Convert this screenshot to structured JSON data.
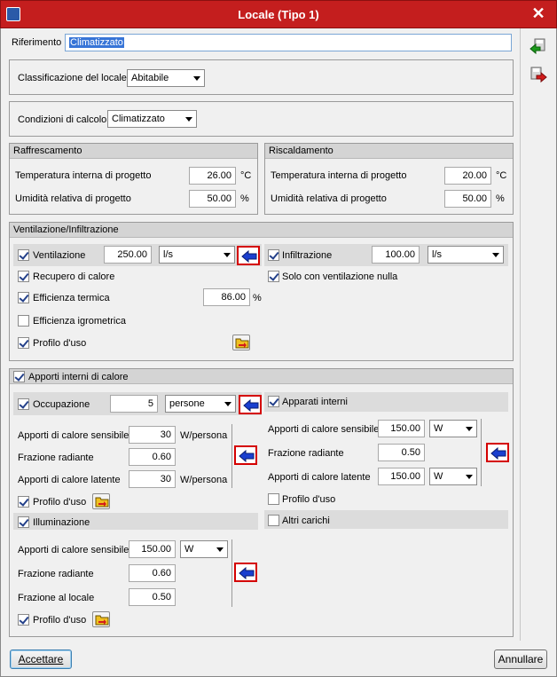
{
  "window": {
    "title": "Locale (Tipo 1)"
  },
  "riferimento": {
    "label": "Riferimento",
    "value": "Climatizzato"
  },
  "classificazione": {
    "label": "Classificazione del locale",
    "value": "Abitabile"
  },
  "condizioni": {
    "label": "Condizioni di calcolo",
    "value": "Climatizzato"
  },
  "raffrescamento": {
    "title": "Raffrescamento",
    "temp_label": "Temperatura interna di progetto",
    "temp_value": "26.00",
    "temp_unit": "°C",
    "umid_label": "Umidità relativa di progetto",
    "umid_value": "50.00",
    "umid_unit": "%"
  },
  "riscaldamento": {
    "title": "Riscaldamento",
    "temp_label": "Temperatura interna di progetto",
    "temp_value": "20.00",
    "temp_unit": "°C",
    "umid_label": "Umidità relativa di progetto",
    "umid_value": "50.00",
    "umid_unit": "%"
  },
  "ventilazione": {
    "title": "Ventilazione/Infiltrazione",
    "vent_label": "Ventilazione",
    "vent_checked": true,
    "vent_value": "250.00",
    "vent_unit": "l/s",
    "infil_label": "Infiltrazione",
    "infil_checked": true,
    "infil_value": "100.00",
    "infil_unit": "l/s",
    "recupero_label": "Recupero di calore",
    "recupero_checked": true,
    "solo_label": "Solo con ventilazione nulla",
    "solo_checked": true,
    "eff_term_label": "Efficienza termica",
    "eff_term_checked": true,
    "eff_term_value": "86.00",
    "eff_term_unit": "%",
    "eff_igro_label": "Efficienza igrometrica",
    "eff_igro_checked": false,
    "profilo_label": "Profilo d'uso",
    "profilo_checked": true
  },
  "apporti": {
    "title": "Apporti interni di calore",
    "checked": true,
    "occupazione": {
      "label": "Occupazione",
      "checked": true,
      "value": "5",
      "unit": "persone",
      "sens_label": "Apporti di calore sensibile",
      "sens_value": "30",
      "sens_unit": "W/persona",
      "rad_label": "Frazione radiante",
      "rad_value": "0.60",
      "lat_label": "Apporti di calore latente",
      "lat_value": "30",
      "lat_unit": "W/persona",
      "profilo_label": "Profilo d'uso",
      "profilo_checked": true
    },
    "apparati": {
      "label": "Apparati interni",
      "checked": true,
      "sens_label": "Apporti di calore sensibile",
      "sens_value": "150.00",
      "sens_unit": "W",
      "rad_label": "Frazione radiante",
      "rad_value": "0.50",
      "lat_label": "Apporti di calore latente",
      "lat_value": "150.00",
      "lat_unit": "W",
      "profilo_label": "Profilo d'uso",
      "profilo_checked": false
    },
    "illuminazione": {
      "label": "Illuminazione",
      "checked": true,
      "sens_label": "Apporti di calore sensibile",
      "sens_value": "150.00",
      "sens_unit": "W",
      "rad_label": "Frazione radiante",
      "rad_value": "0.60",
      "locale_label": "Frazione al locale",
      "locale_value": "0.50",
      "profilo_label": "Profilo d'uso",
      "profilo_checked": true
    },
    "altri": {
      "label": "Altri carichi",
      "checked": false
    }
  },
  "buttons": {
    "accept": "Accettare",
    "cancel": "Annullare"
  },
  "colors": {
    "titlebar": "#c41e1e",
    "arrow_border": "#d40000",
    "arrow_fill": "#1a3fcf"
  }
}
